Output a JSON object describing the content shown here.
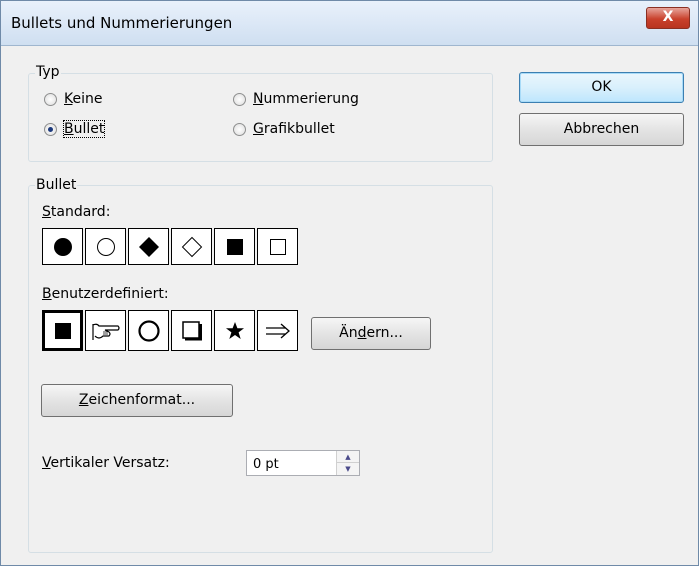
{
  "window": {
    "title": "Bullets und Nummerierungen",
    "close_glyph": "X"
  },
  "typ": {
    "legend": "Typ",
    "options": [
      {
        "label": "Keine",
        "accel": "K",
        "rest": "eine",
        "selected": false
      },
      {
        "label": "Nummerierung",
        "accel": "N",
        "rest": "ummerierung",
        "selected": false
      },
      {
        "label": "Bullet",
        "accel": "B",
        "rest": "ullet",
        "selected": true
      },
      {
        "label": "Grafikbullet",
        "accel": "G",
        "rest": "rafikbullet",
        "selected": false
      }
    ]
  },
  "bullet": {
    "legend": "Bullet",
    "standard_label_accel": "S",
    "standard_label_rest": "tandard:",
    "standard_items": [
      "filled-circle",
      "hollow-circle",
      "filled-diamond",
      "hollow-diamond",
      "filled-square",
      "hollow-square"
    ],
    "custom_label_accel": "B",
    "custom_label_rest": "enutzerdefiniert:",
    "custom_items": [
      "filled-square",
      "pointing-hand",
      "hollow-circle",
      "shadowed-square",
      "star",
      "double-arrow"
    ],
    "custom_selected_index": 0,
    "change_button_pre": "Än",
    "change_button_accel": "d",
    "change_button_post": "ern...",
    "charformat_button_accel": "Z",
    "charformat_button_rest": "eichenformat...",
    "offset_label_accel": "V",
    "offset_label_rest": "ertikaler Versatz:",
    "offset_value": "0 pt"
  },
  "buttons": {
    "ok": "OK",
    "cancel": "Abbrechen"
  }
}
